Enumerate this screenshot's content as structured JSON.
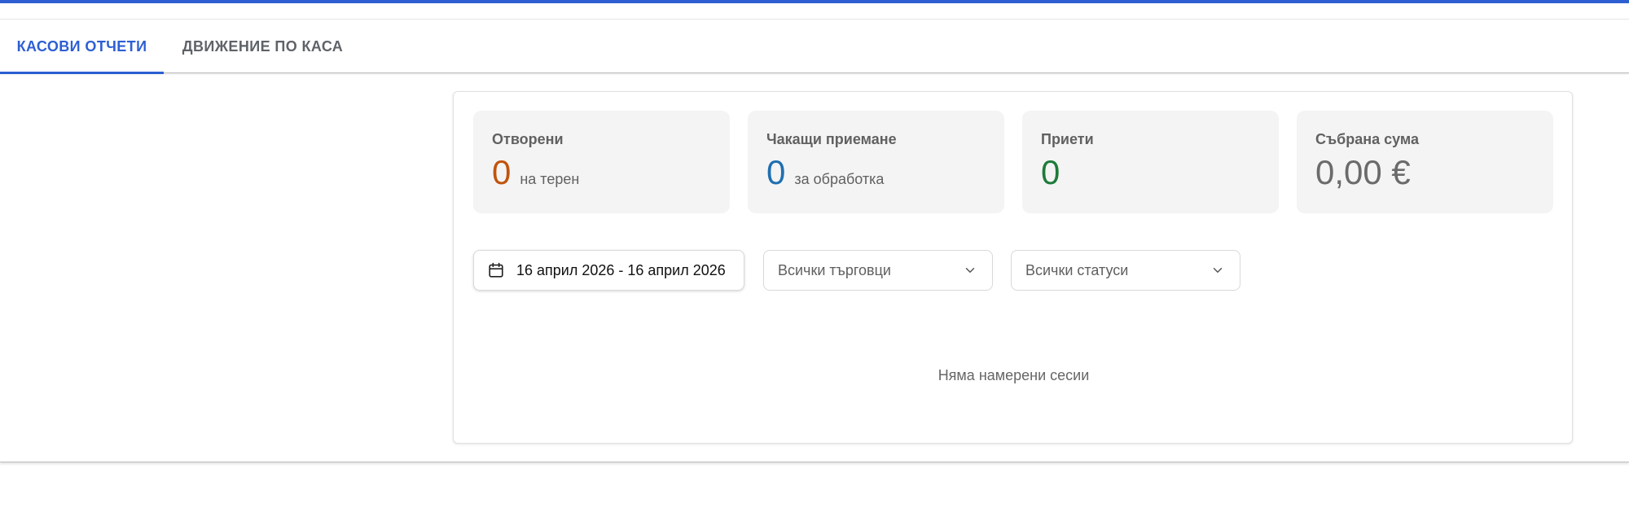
{
  "tabs": [
    {
      "label": "КАСОВИ ОТЧЕТИ",
      "active": true
    },
    {
      "label": "ДВИЖЕНИЕ ПО КАСА",
      "active": false
    }
  ],
  "stats": [
    {
      "label": "Отворени",
      "value": "0",
      "sub": "на терен",
      "color": "#c0540c"
    },
    {
      "label": "Чакащи приемане",
      "value": "0",
      "sub": "за обработка",
      "color": "#1e6fb0"
    },
    {
      "label": "Приети",
      "value": "0",
      "sub": "",
      "color": "#1d7b39"
    },
    {
      "label": "Събрана сума",
      "value": "0,00 €",
      "sub": "",
      "color": "#6b6b6b"
    }
  ],
  "filters": {
    "date_range": "16 април 2026 - 16 април 2026",
    "merchants": "Всички търговци",
    "statuses": "Всички статуси"
  },
  "empty_message": "Няма намерени сесии",
  "icons": {
    "date": "calendar-icon",
    "dropdown": "chevron-down-icon"
  },
  "colors": {
    "accent": "#2d5fd3"
  }
}
